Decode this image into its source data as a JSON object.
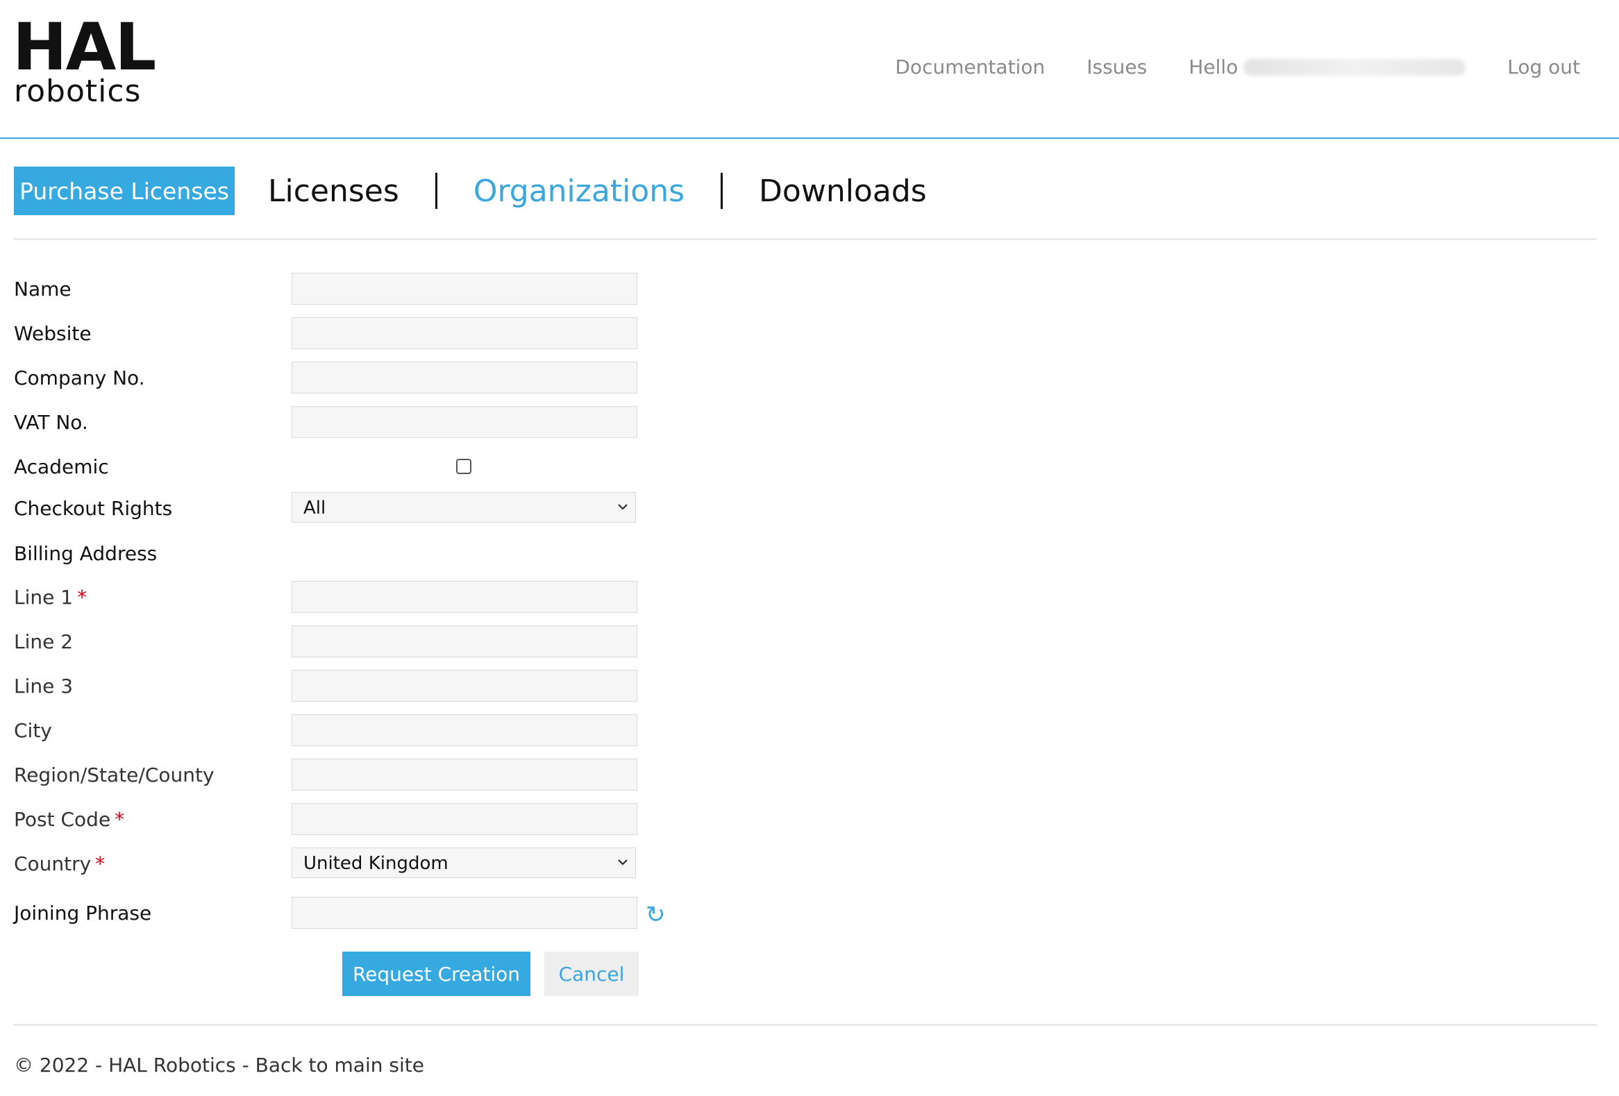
{
  "header": {
    "logo_top": "HAL",
    "logo_bottom": "robotics",
    "nav": {
      "documentation": "Documentation",
      "issues": "Issues",
      "hello": "Hello",
      "logout": "Log out"
    }
  },
  "tabs": {
    "purchase": "Purchase Licenses",
    "licenses": "Licenses",
    "organizations": "Organizations",
    "downloads": "Downloads"
  },
  "form": {
    "name": "Name",
    "website": "Website",
    "company_no": "Company No.",
    "vat_no": "VAT No.",
    "academic": "Academic",
    "checkout_rights": "Checkout Rights",
    "checkout_rights_value": "All",
    "billing_address": "Billing Address",
    "line1": "Line 1",
    "line2": "Line 2",
    "line3": "Line 3",
    "city": "City",
    "region": "Region/State/County",
    "post_code": "Post Code",
    "country": "Country",
    "country_value": "United Kingdom",
    "joining_phrase": "Joining Phrase",
    "required_mark": "*"
  },
  "actions": {
    "request": "Request Creation",
    "cancel": "Cancel"
  },
  "footer": {
    "text": "© 2022 - HAL Robotics - Back to main site"
  },
  "colors": {
    "accent": "#36a9e1",
    "required": "#d0021b"
  }
}
